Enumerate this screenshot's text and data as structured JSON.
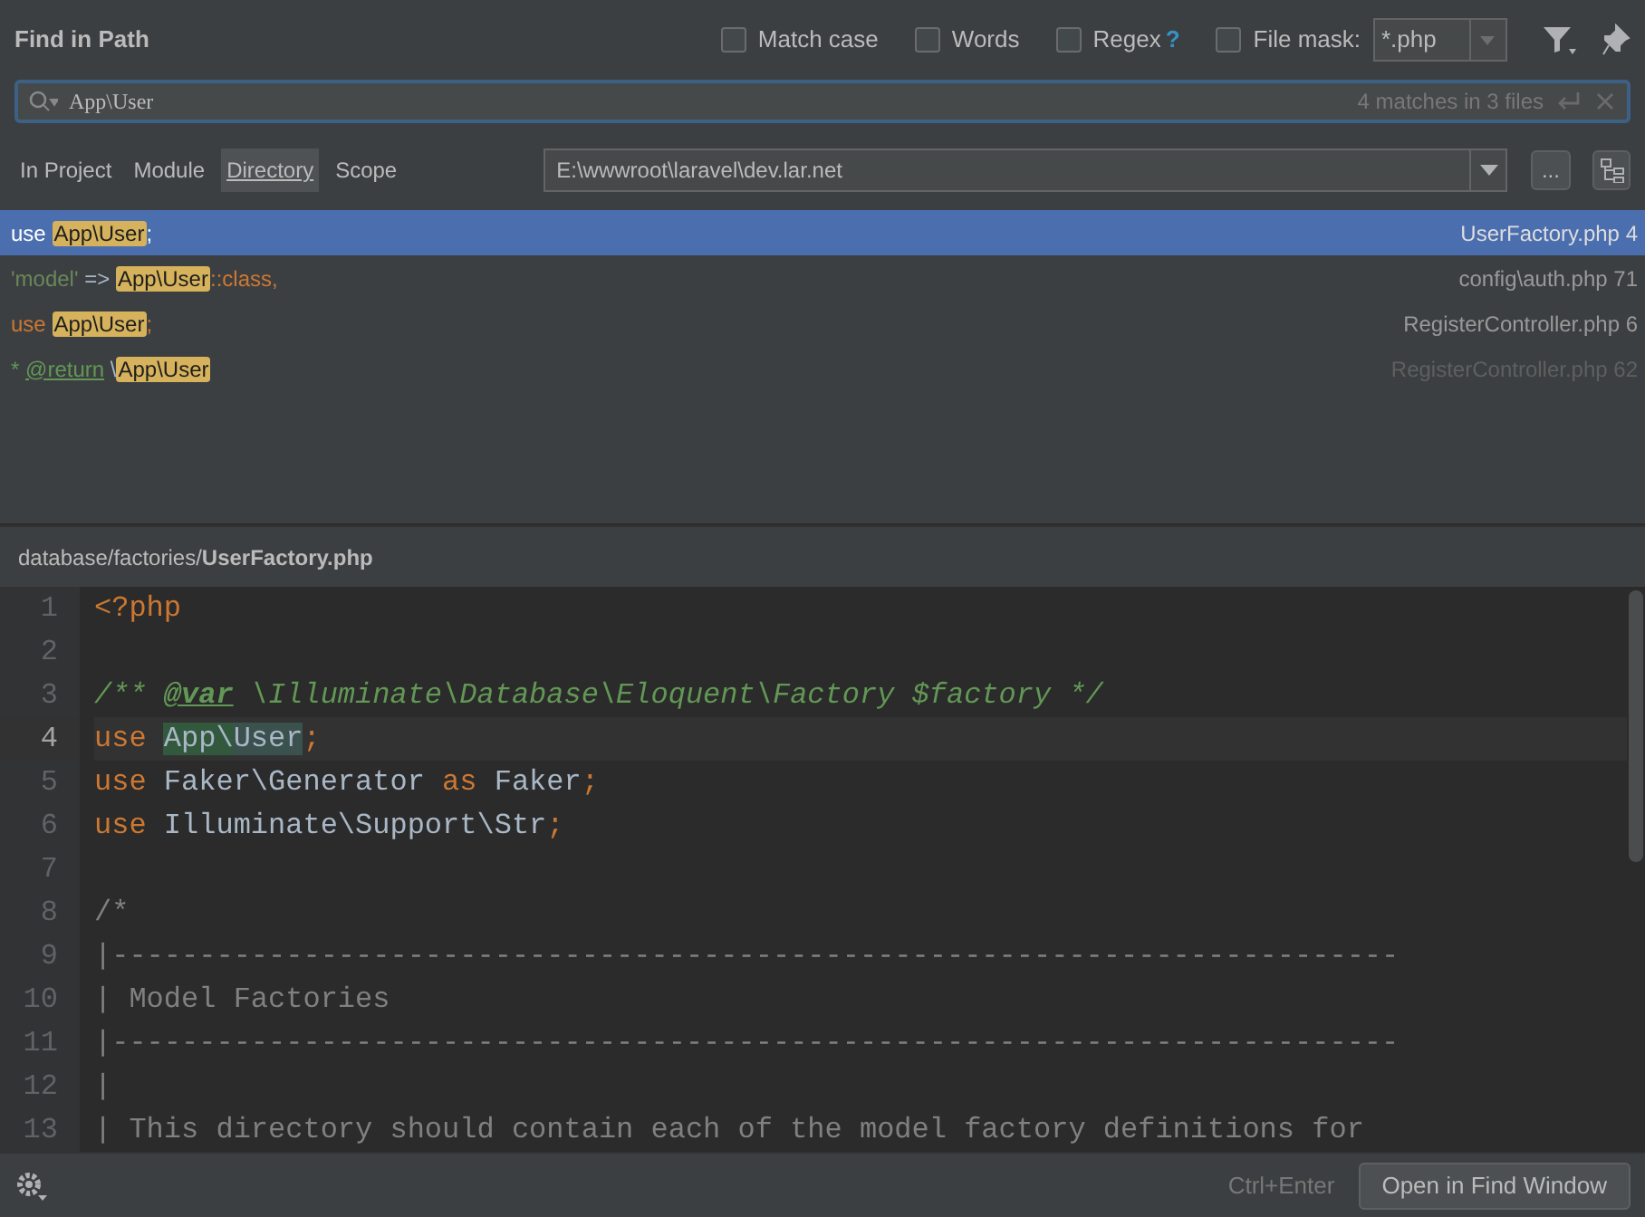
{
  "window": {
    "title": "Find in Path"
  },
  "options": [
    {
      "label": "Match case",
      "checked": false
    },
    {
      "label": "Words",
      "checked": false
    },
    {
      "label": "Regex",
      "checked": false,
      "help": "?"
    }
  ],
  "file_mask": {
    "label": "File mask:",
    "checked": false,
    "value": "*.php"
  },
  "search": {
    "value": "App\\User",
    "match_count": "4 matches in 3 files"
  },
  "scopes": [
    {
      "label": "In Project",
      "selected": false
    },
    {
      "label": "Module",
      "selected": false
    },
    {
      "label": "Directory",
      "selected": true
    },
    {
      "label": "Scope",
      "selected": false
    }
  ],
  "directory": {
    "value": "E:\\wwwroot\\laravel\\dev.lar.net",
    "browse": "..."
  },
  "results": [
    {
      "selected": true,
      "dimmed": false,
      "file": "UserFactory.php 4",
      "segments": [
        {
          "kind": "keyword",
          "text": "use "
        },
        {
          "kind": "match",
          "text": "App\\User"
        },
        {
          "kind": "keyword",
          "text": ";"
        }
      ]
    },
    {
      "selected": false,
      "dimmed": false,
      "file": "config\\auth.php 71",
      "segments": [
        {
          "kind": "string",
          "text": "'model'"
        },
        {
          "kind": "plain",
          "text": " => "
        },
        {
          "kind": "match",
          "text": "App\\User"
        },
        {
          "kind": "keyword",
          "text": "::class,"
        }
      ]
    },
    {
      "selected": false,
      "dimmed": false,
      "file": "RegisterController.php 6",
      "segments": [
        {
          "kind": "keyword",
          "text": "use "
        },
        {
          "kind": "match",
          "text": "App\\User"
        },
        {
          "kind": "keyword",
          "text": ";"
        }
      ]
    },
    {
      "selected": false,
      "dimmed": true,
      "file": "RegisterController.php 62",
      "segments": [
        {
          "kind": "doc",
          "text": "* "
        },
        {
          "kind": "doctag",
          "text": "@return"
        },
        {
          "kind": "plain",
          "text": " \\"
        },
        {
          "kind": "match",
          "text": "App\\User"
        }
      ]
    }
  ],
  "preview": {
    "path": "database/factories/**UserFactory.php**",
    "lines": [
      {
        "number": "1",
        "current": false,
        "tokens": [
          {
            "kind": "keyword",
            "text": "<?php"
          }
        ]
      },
      {
        "number": "2",
        "current": false
      },
      {
        "number": "3",
        "current": false,
        "tokens": [
          {
            "kind": "doc",
            "text": "/** "
          },
          {
            "kind": "doctag",
            "text": "@var"
          },
          {
            "kind": "doc",
            "text": " \\Illuminate\\Database\\Eloquent\\Factory $factory */"
          }
        ]
      },
      {
        "number": "4",
        "current": true,
        "tokens": [
          {
            "kind": "keyword",
            "text": "use "
          },
          {
            "kind": "found",
            "text": "App\\"
          },
          {
            "kind": "usage",
            "text": "User"
          },
          {
            "kind": "keyword",
            "text": ";"
          }
        ]
      },
      {
        "number": "5",
        "current": false,
        "tokens": [
          {
            "kind": "keyword",
            "text": "use "
          },
          {
            "kind": "plain",
            "text": "Faker\\Generator "
          },
          {
            "kind": "keyword",
            "text": "as "
          },
          {
            "kind": "plain",
            "text": "Faker"
          },
          {
            "kind": "keyword",
            "text": ";"
          }
        ]
      },
      {
        "number": "6",
        "current": false,
        "tokens": [
          {
            "kind": "keyword",
            "text": "use "
          },
          {
            "kind": "plain",
            "text": "Illuminate\\Support\\Str"
          },
          {
            "kind": "keyword",
            "text": ";"
          }
        ]
      },
      {
        "number": "7",
        "current": false
      },
      {
        "number": "8",
        "current": false,
        "tokens": [
          {
            "kind": "comment",
            "text": "/*"
          }
        ]
      },
      {
        "number": "9",
        "current": false,
        "tokens": [
          {
            "kind": "comment",
            "text": "|--------------------------------------------------------------------------"
          }
        ]
      },
      {
        "number": "10",
        "current": false,
        "tokens": [
          {
            "kind": "comment",
            "text": "| Model Factories"
          }
        ]
      },
      {
        "number": "11",
        "current": false,
        "tokens": [
          {
            "kind": "comment",
            "text": "|--------------------------------------------------------------------------"
          }
        ]
      },
      {
        "number": "12",
        "current": false,
        "tokens": [
          {
            "kind": "comment",
            "text": "|"
          }
        ]
      },
      {
        "number": "13",
        "current": false,
        "tokens": [
          {
            "kind": "comment",
            "text": "| This directory should contain each of the model factory definitions for"
          }
        ]
      }
    ]
  },
  "footer": {
    "shortcut": "Ctrl+Enter",
    "button": "Open in Find Window"
  }
}
